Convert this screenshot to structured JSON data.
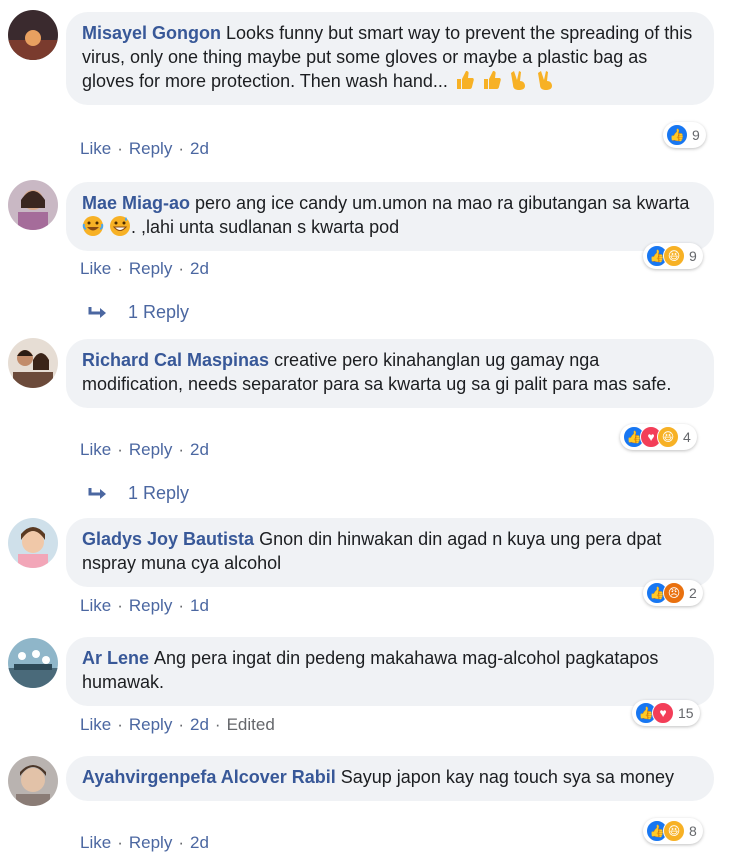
{
  "comments": [
    {
      "author": "Misayel Gongon",
      "text": "Looks funny but smart way to prevent the spreading of this virus, only one thing maybe put some gloves or maybe a plastic bag as gloves for more protection. Then wash hand...",
      "emoji": [
        "thumbs-up",
        "thumbs-up",
        "victory-hand",
        "victory-hand"
      ],
      "like": "Like",
      "reply": "Reply",
      "time": "2d",
      "reactions": [
        "like"
      ],
      "reaction_count": "9"
    },
    {
      "author": "Mae Miag-ao",
      "text": "pero ang ice candy um.umon na mao ra gibutangan sa kwarta",
      "text_after_emoji": ". ,lahi unta sudlanan s kwarta pod",
      "emoji": [
        "tears-of-joy",
        "grinning-sweat"
      ],
      "like": "Like",
      "reply": "Reply",
      "time": "2d",
      "reactions": [
        "like",
        "haha"
      ],
      "reaction_count": "9",
      "replies_label": "1 Reply"
    },
    {
      "author": "Richard Cal Maspinas",
      "text": "creative pero kinahanglan ug gamay nga modification, needs separator para sa kwarta ug sa gi palit para mas safe.",
      "like": "Like",
      "reply": "Reply",
      "time": "2d",
      "reactions": [
        "like",
        "love",
        "haha"
      ],
      "reaction_count": "4",
      "replies_label": "1 Reply"
    },
    {
      "author": "Gladys Joy Bautista",
      "text": "Gnon din hinwakan din agad n kuya ung pera dpat nspray muna cya alcohol",
      "like": "Like",
      "reply": "Reply",
      "time": "1d",
      "reactions": [
        "like",
        "angry"
      ],
      "reaction_count": "2"
    },
    {
      "author": "Ar Lene",
      "text": "Ang pera ingat din pedeng makahawa mag-alcohol pagkatapos humawak.",
      "like": "Like",
      "reply": "Reply",
      "time": "2d",
      "edited": "Edited",
      "reactions": [
        "like",
        "love"
      ],
      "reaction_count": "15"
    },
    {
      "author": "Ayahvirgenpefa Alcover Rabil",
      "text": "Sayup japon kay nag touch sya sa money",
      "like": "Like",
      "reply": "Reply",
      "time": "2d",
      "reactions": [
        "like",
        "haha"
      ],
      "reaction_count": "8"
    }
  ],
  "colors": {
    "author": "#385898",
    "bubble": "#f0f2f5",
    "link": "#4b67a1",
    "like": "#1877f2",
    "love": "#f33e58",
    "haha": "#f7b125",
    "angry": "#e9710f"
  }
}
